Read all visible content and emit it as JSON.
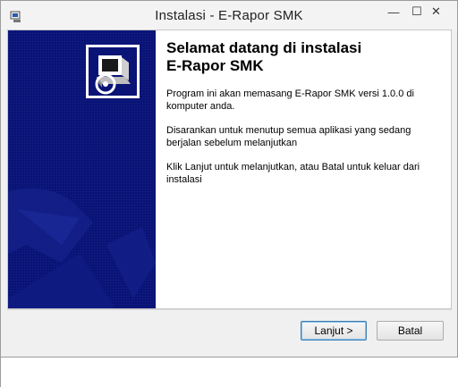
{
  "window": {
    "title": "Instalasi - E-Rapor SMK",
    "minimize_glyph": "—",
    "maximize_glyph": "☐",
    "close_glyph": "✕"
  },
  "welcome": {
    "heading_line1": "Selamat datang di instalasi",
    "heading_line2": "E-Rapor SMK",
    "paragraph1": "Program ini akan memasang E-Rapor SMK versi 1.0.0 di komputer anda.",
    "paragraph2": "Disarankan untuk menutup semua aplikasi yang sedang berjalan sebelum melanjutkan",
    "paragraph3": "Klik Lanjut untuk melanjutkan, atau Batal untuk keluar dari instalasi"
  },
  "buttons": {
    "next_label": "Lanjut >",
    "cancel_label": "Batal"
  },
  "colors": {
    "side_panel": "#0a1476",
    "accent": "#3c7fb1"
  },
  "icons": {
    "app": "installer-app-icon",
    "logo": "computer-disc-logo-icon"
  }
}
